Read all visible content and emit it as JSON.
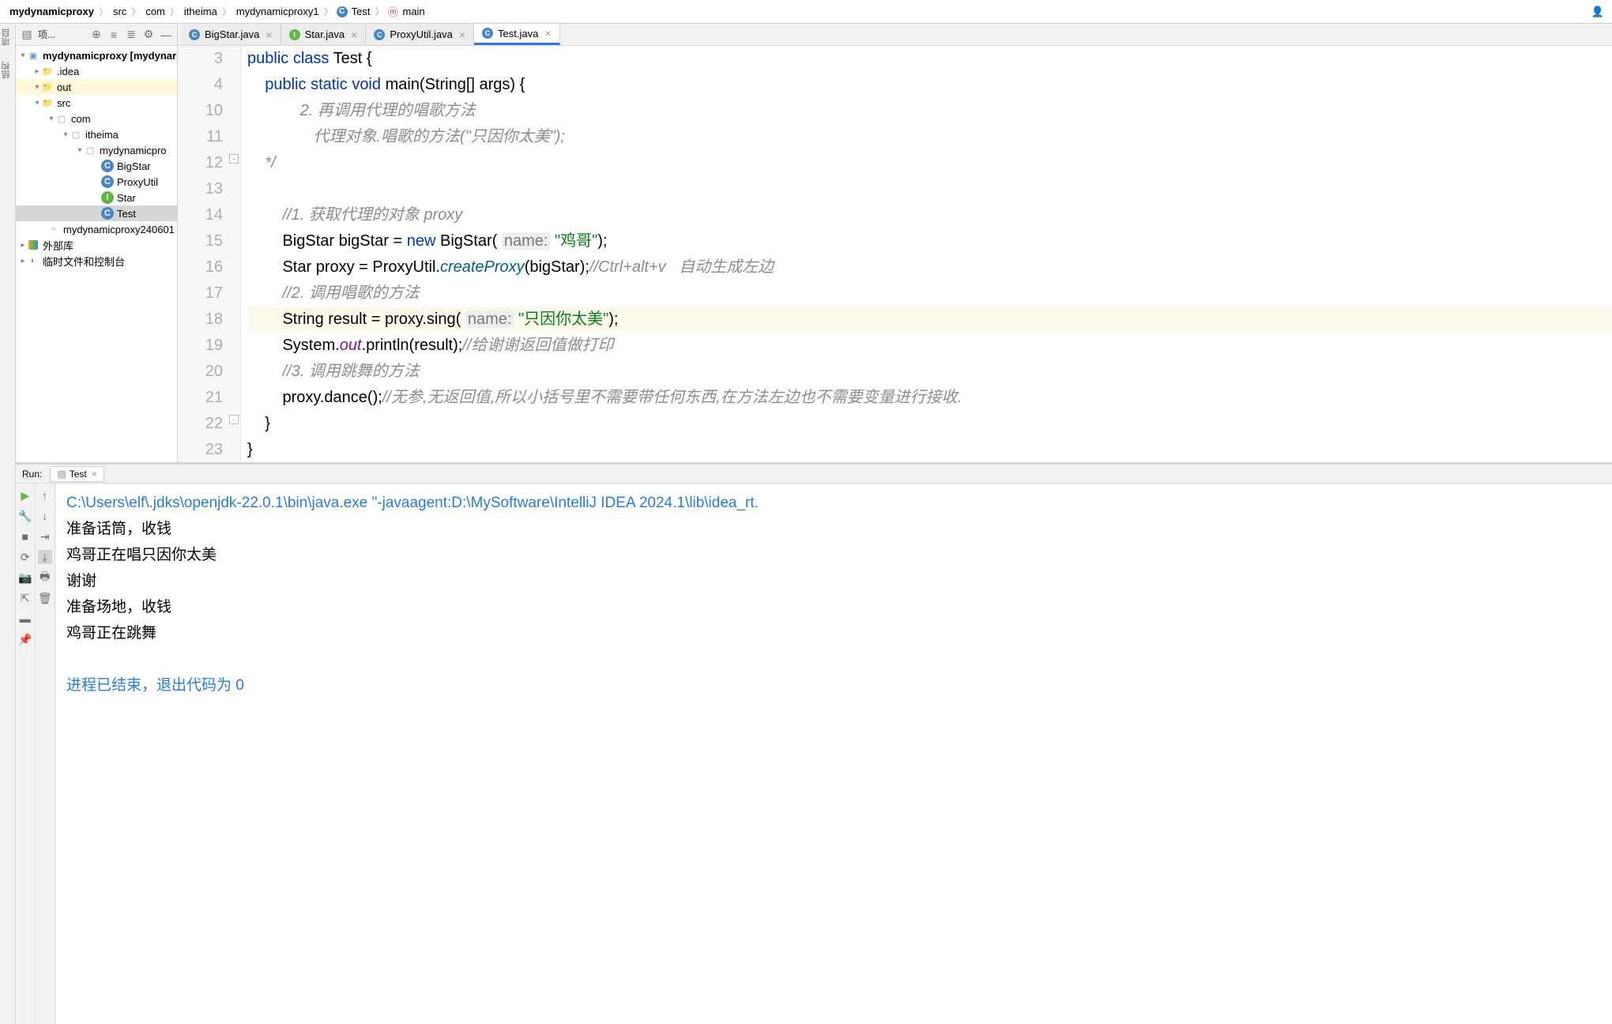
{
  "breadcrumb": {
    "segs": [
      "mydynamicproxy",
      "src",
      "com",
      "itheima",
      "mydynamicproxy1",
      "Test",
      "main"
    ]
  },
  "leftRail": {
    "tab1": "项目",
    "tab2": "结构"
  },
  "projToolbar": {
    "label": "项..."
  },
  "tree": {
    "n0": "mydynamicproxy [mydynar",
    "n1": ".idea",
    "n2": "out",
    "n3": "src",
    "n4": "com",
    "n5": "itheima",
    "n6": "mydynamicpro",
    "n7": "BigStar",
    "n8": "ProxyUtil",
    "n9": "Star",
    "n10": "Test",
    "n11": "mydynamicproxy240601",
    "n12": "外部库",
    "n13": "临时文件和控制台"
  },
  "tabs": {
    "t0": "BigStar.java",
    "t1": "Star.java",
    "t2": "ProxyUtil.java",
    "t3": "Test.java"
  },
  "gutter": [
    "3",
    "4",
    "10",
    "11",
    "12",
    "13",
    "14",
    "15",
    "16",
    "17",
    "18",
    "19",
    "20",
    "21",
    "22",
    "23"
  ],
  "code": {
    "l3a": "public",
    "l3b": "class",
    "l3c": " Test {",
    "l4a": "public",
    "l4b": "static",
    "l4c": "void",
    "l4d": " main(String[] args) {",
    "l10": "            2. 再调用代理的唱歌方法",
    "l11": "               代理对象.唱歌的方法(\"只因你太美\");",
    "l12": "    */",
    "l14": "        //1. 获取代理的对象 proxy",
    "l15a": "        BigStar bigStar = ",
    "l15b": "new",
    "l15c": " BigStar( ",
    "l15h": "name:",
    "l15d": " \"鸡哥\"",
    "l15e": ");",
    "l16a": "        Star proxy = ProxyUtil.",
    "l16m": "createProxy",
    "l16b": "(bigStar);",
    "l16c": "//Ctrl+alt+v   自动生成左边",
    "l17": "        //2. 调用唱歌的方法",
    "l18a": "        String result = proxy.sing( ",
    "l18h": "name:",
    "l18b": " \"只因你太美\"",
    "l18c": ");",
    "l19a": "        System.",
    "l19f": "out",
    "l19b": ".println(result);",
    "l19c": "//给谢谢返回值做打印",
    "l20": "        //3. 调用跳舞的方法",
    "l21a": "        proxy.dance();",
    "l21b": "//无参,无返回值,所以小括号里不需要带任何东西,在方法左边也不需要变量进行接收.",
    "l22": "    }",
    "l23": "}"
  },
  "run": {
    "label": "Run:",
    "tab": "Test",
    "cmd": "C:\\Users\\elf\\.jdks\\openjdk-22.0.1\\bin\\java.exe \"-javaagent:D:\\MySoftware\\IntelliJ IDEA 2024.1\\lib\\idea_rt.",
    "o1": "准备话筒，收钱",
    "o2": "鸡哥正在唱只因你太美",
    "o3": "谢谢",
    "o4": "准备场地，收钱",
    "o5": "鸡哥正在跳舞",
    "exit": "进程已结束，退出代码为 0"
  }
}
